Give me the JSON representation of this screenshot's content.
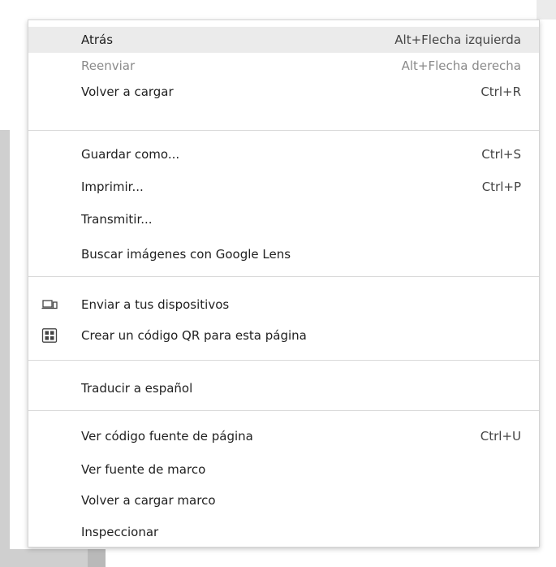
{
  "menu": {
    "items": [
      {
        "label": "Atrás",
        "shortcut": "Alt+Flecha izquierda"
      },
      {
        "label": "Reenviar",
        "shortcut": "Alt+Flecha derecha"
      },
      {
        "label": "Volver a cargar",
        "shortcut": "Ctrl+R"
      },
      {
        "label": "Guardar como...",
        "shortcut": "Ctrl+S"
      },
      {
        "label": "Imprimir...",
        "shortcut": "Ctrl+P"
      },
      {
        "label": "Transmitir..."
      },
      {
        "label": "Buscar imágenes con Google Lens"
      },
      {
        "label": "Enviar a tus dispositivos",
        "icon": "send-to-devices-icon"
      },
      {
        "label": "Crear un código QR para esta página",
        "icon": "qr-code-icon"
      },
      {
        "label": "Traducir a español"
      },
      {
        "label": "Ver código fuente de página",
        "shortcut": "Ctrl+U"
      },
      {
        "label": "Ver fuente de marco"
      },
      {
        "label": "Volver a cargar marco"
      },
      {
        "label": "Inspeccionar"
      }
    ]
  },
  "colors": {
    "highlight": "#ebebeb",
    "text": "#1f1f1f",
    "disabled_text": "#8a8a8a",
    "separator": "#d9d9d9"
  }
}
